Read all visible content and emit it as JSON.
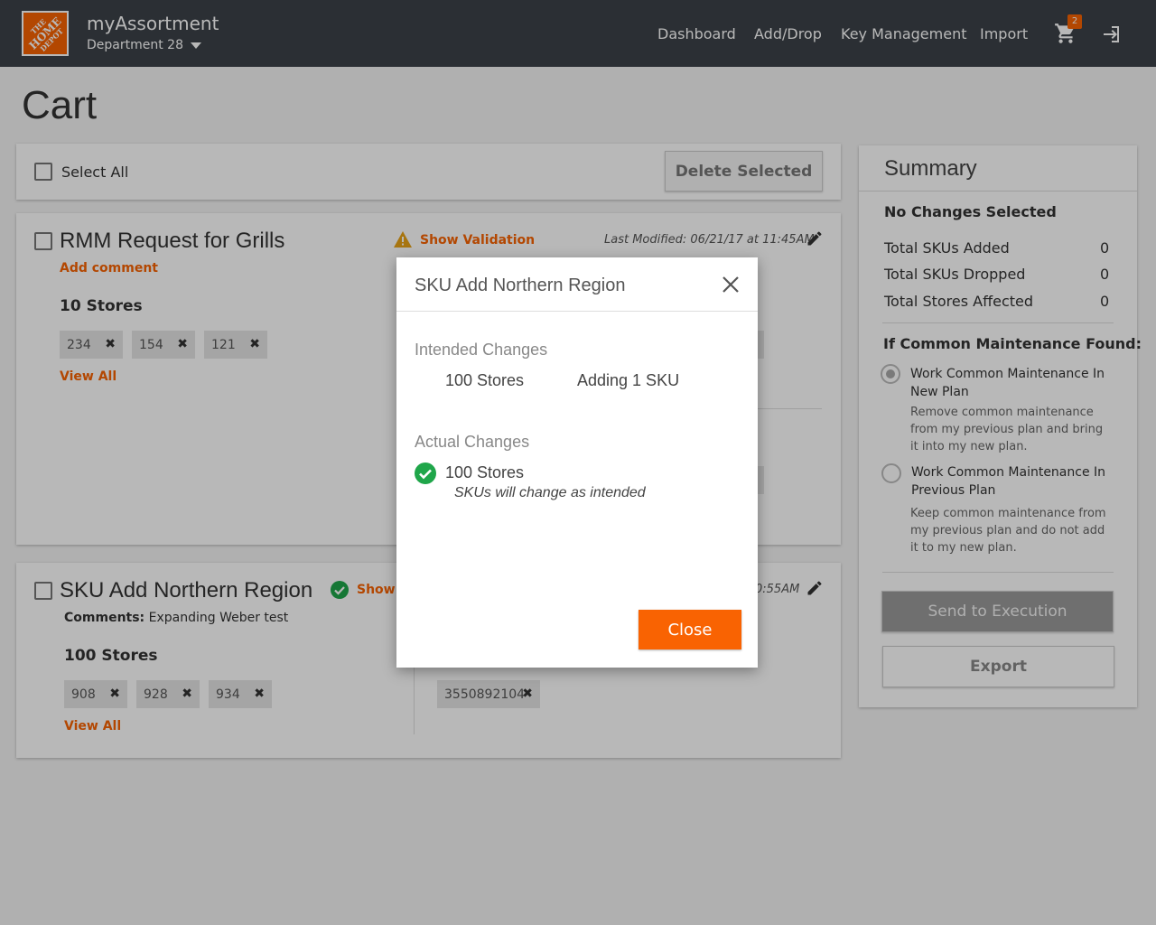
{
  "header": {
    "app_title": "myAssortment",
    "department": "Department 28",
    "logo_text_top": "THE",
    "logo_text_mid": "HOME",
    "logo_text_bot": "DEPOT",
    "nav": [
      "Dashboard",
      "Add/Drop",
      "Key Management",
      "Import"
    ],
    "cart_count": "2",
    "brand_color": "#f96302",
    "bar_color": "#3c4248"
  },
  "page": {
    "title": "Cart"
  },
  "toolbar": {
    "select_all": "Select All",
    "delete_selected": "Delete Selected"
  },
  "cards": [
    {
      "title": "RMM Request for Grills",
      "validation": "Show Validation",
      "comment_link": "Add comment",
      "last_modified": "Last Modified: 06/21/17 at 11:45AM",
      "stores": "10 Stores",
      "chips": [
        "234",
        "154",
        "121"
      ],
      "view_all": "View All"
    },
    {
      "title": "SKU Add Northern Region",
      "validation": "Show V",
      "comments_label": "Comments:",
      "comments_text": "Expanding Weber test",
      "last_modified_tail": "0:55AM",
      "stores": "100 Stores",
      "chips": [
        "908",
        "928",
        "934"
      ],
      "sku_chip": "3550892104",
      "view_all": "View All"
    }
  ],
  "summary": {
    "title": "Summary",
    "status": "No Changes Selected",
    "rows": [
      {
        "label": "Total SKUs Added",
        "value": "0"
      },
      {
        "label": "Total SKUs Dropped",
        "value": "0"
      },
      {
        "label": "Total Stores Affected",
        "value": "0"
      }
    ],
    "cm_heading": "If Common Maintenance Found:",
    "option1_label": "Work Common Maintenance In New Plan",
    "option1_desc": "Remove common maintenance from my previous plan and bring it into my new plan.",
    "option2_label": "Work Common Maintenance In Previous Plan",
    "option2_desc": "Keep common maintenance from my previous plan and do not add it to my new plan.",
    "send_button": "Send to Execution",
    "export_button": "Export"
  },
  "modal": {
    "title": "SKU Add Northern Region",
    "intended_heading": "Intended Changes",
    "intended_stores": "100 Stores",
    "intended_skus": "Adding 1 SKU",
    "actual_heading": "Actual Changes",
    "actual_stores": "100 Stores",
    "actual_note": "SKUs will change as intended",
    "close_button": "Close",
    "success_color": "#1fa64a"
  }
}
